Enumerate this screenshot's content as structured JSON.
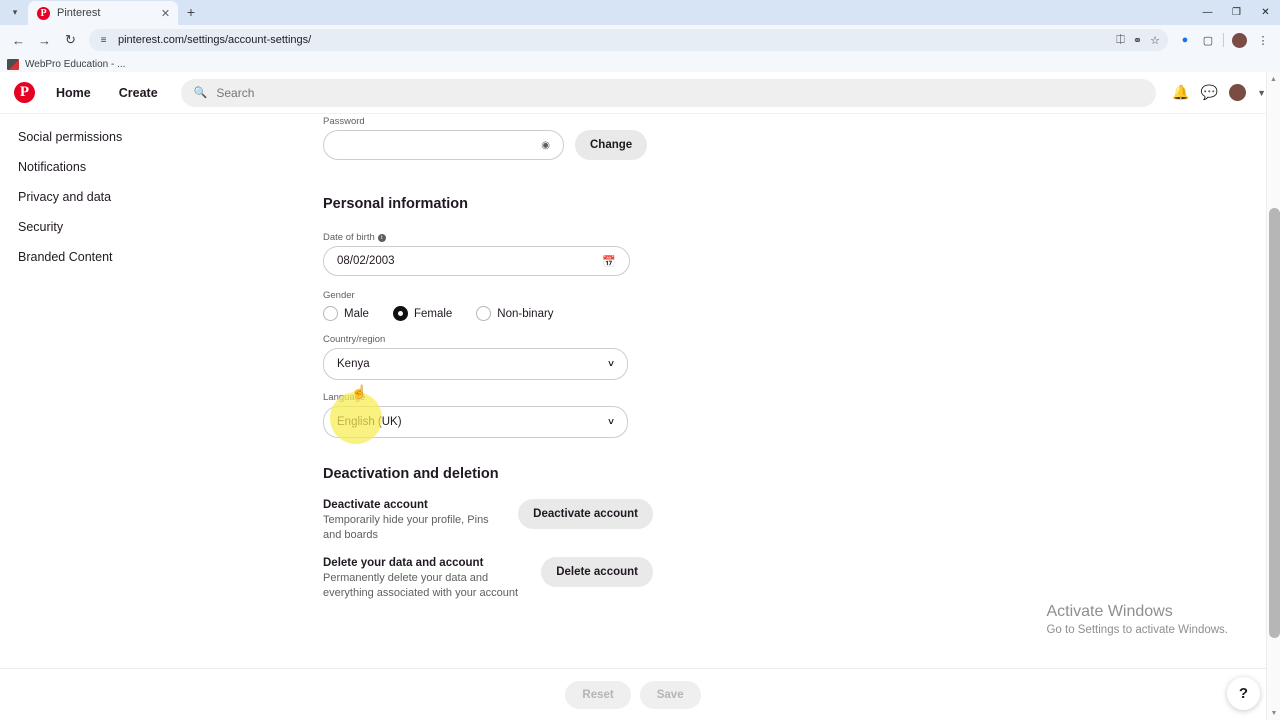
{
  "browser": {
    "tab": {
      "title": "Pinterest",
      "favicon": "pinterest-icon",
      "close": "✕"
    },
    "tab_list_icon": "chevron-down-icon",
    "new_tab": "+",
    "window_controls": {
      "minimize": "—",
      "maximize": "❐",
      "close": "✕"
    },
    "nav": {
      "back": "←",
      "forward": "→",
      "reload": "↻"
    },
    "omnibox": {
      "site_settings_icon": "tune-icon",
      "url": "pinterest.com/settings/account-settings/"
    },
    "omnibox_actions": {
      "cast": "screen-share-icon",
      "glasses": "eye-off-icon",
      "bookmark": "star-icon"
    },
    "extensions": {
      "sync": "sync-badge-icon",
      "puzzle": "extensions-icon",
      "menu": "⋮"
    },
    "bookmarks": [
      {
        "label": "WebPro Education - ...",
        "favicon": "webpro-icon"
      }
    ]
  },
  "pinterest": {
    "logo": "pinterest-logo",
    "nav": [
      {
        "label": "Home"
      },
      {
        "label": "Create"
      }
    ],
    "search": {
      "placeholder": "Search",
      "icon": "search-icon"
    },
    "header_actions": {
      "notifications": "bell-icon",
      "messages": "chat-icon",
      "avatar": "user-avatar",
      "chevron": "chevron-down-icon"
    }
  },
  "sidebar": {
    "items": [
      {
        "label": "Social permissions"
      },
      {
        "label": "Notifications"
      },
      {
        "label": "Privacy and data"
      },
      {
        "label": "Security"
      },
      {
        "label": "Branded Content"
      }
    ]
  },
  "main": {
    "password": {
      "label": "Password",
      "value": "",
      "reveal_icon": "eye-icon",
      "change_button": "Change"
    },
    "personal_information": {
      "heading": "Personal information",
      "date_of_birth": {
        "label": "Date of birth",
        "info_icon": "info-icon",
        "value": "08/02/2003",
        "calendar_icon": "calendar-icon"
      },
      "gender": {
        "label": "Gender",
        "options": [
          {
            "label": "Male",
            "selected": false
          },
          {
            "label": "Female",
            "selected": true
          },
          {
            "label": "Non-binary",
            "selected": false
          }
        ]
      },
      "country": {
        "label": "Country/region",
        "value": "Kenya",
        "chevron": "chevron-down-icon"
      },
      "language": {
        "label": "Language",
        "value": "English (UK)",
        "chevron": "chevron-down-icon"
      }
    },
    "deactivation": {
      "heading": "Deactivation and deletion",
      "rows": [
        {
          "title": "Deactivate account",
          "description": "Temporarily hide your profile, Pins and boards",
          "button": "Deactivate account"
        },
        {
          "title": "Delete your data and account",
          "description": "Permanently delete your data and everything associated with your account",
          "button": "Delete account"
        }
      ]
    }
  },
  "footer": {
    "reset_button": "Reset",
    "save_button": "Save"
  },
  "help_fab": {
    "label": "?"
  },
  "windows_watermark": {
    "title": "Activate Windows",
    "subtitle": "Go to Settings to activate Windows."
  },
  "colors": {
    "brand_red": "#e60023",
    "highlight_yellow": "#f6ec4f",
    "chrome_blue": "#d6e4f5"
  }
}
